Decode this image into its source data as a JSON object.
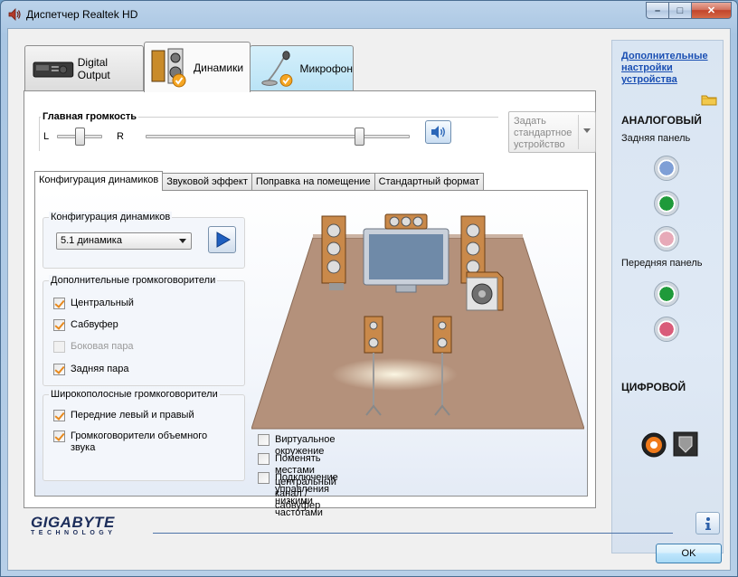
{
  "window": {
    "title": "Диспетчер Realtek HD"
  },
  "device_tabs": [
    {
      "label": "Digital Output",
      "active": false
    },
    {
      "label": "Динамики",
      "active": true
    },
    {
      "label": "Микрофон",
      "active": false
    }
  ],
  "master_volume": {
    "title": "Главная громкость",
    "left_label": "L",
    "right_label": "R",
    "balance_fraction": 0.5,
    "volume_fraction": 0.81
  },
  "default_device_button": {
    "label": "Задать стандартное устройство",
    "line1": "Задать",
    "line2": "стандартное",
    "line3": "устройство"
  },
  "sub_tabs": [
    {
      "label": "Конфигурация динамиков",
      "active": true
    },
    {
      "label": "Звуковой эффект",
      "active": false
    },
    {
      "label": "Поправка на помещение",
      "active": false
    },
    {
      "label": "Стандартный формат",
      "active": false
    }
  ],
  "speaker_config": {
    "title": "Конфигурация динамиков",
    "selected": "5.1 динамика"
  },
  "extra_speakers": {
    "title": "Дополнительные громкоговорители",
    "items": [
      {
        "label": "Центральный",
        "checked": true,
        "disabled": false
      },
      {
        "label": "Сабвуфер",
        "checked": true,
        "disabled": false
      },
      {
        "label": "Боковая пара",
        "checked": false,
        "disabled": true
      },
      {
        "label": "Задняя пара",
        "checked": true,
        "disabled": false
      }
    ]
  },
  "fullrange_speakers": {
    "title": "Широкополосные громкоговорители",
    "items": [
      {
        "label": "Передние левый и правый",
        "checked": true
      },
      {
        "label": "Громкоговорители объемного звука",
        "line1": "Громкоговорители объемного",
        "line2": "звука",
        "checked": true
      }
    ]
  },
  "bottom_options": [
    {
      "label": "Виртуальное окружение",
      "checked": false
    },
    {
      "label": "Поменять местами центральный канал / сабвуфер",
      "checked": false
    },
    {
      "label": "Подключение управления низкими частотами",
      "checked": false
    }
  ],
  "right_panel": {
    "advanced_link": "Дополнительные настройки устройства",
    "link_line1": "Дополнительные",
    "link_line2": "настройки",
    "link_line3": "устройства",
    "analog_title": "АНАЛОГОВЫЙ",
    "rear_panel": "Задняя панель",
    "front_panel": "Передняя панель",
    "digital_title": "ЦИФРОВОЙ",
    "rear_jacks": [
      "#7f9fd6",
      "#1f9a3a",
      "#e7aab8"
    ],
    "front_jacks": [
      "#1f9a3a",
      "#d95c7a"
    ]
  },
  "brand": {
    "name": "GIGABYTE",
    "tagline": "TECHNOLOGY"
  },
  "buttons": {
    "ok": "OK"
  }
}
